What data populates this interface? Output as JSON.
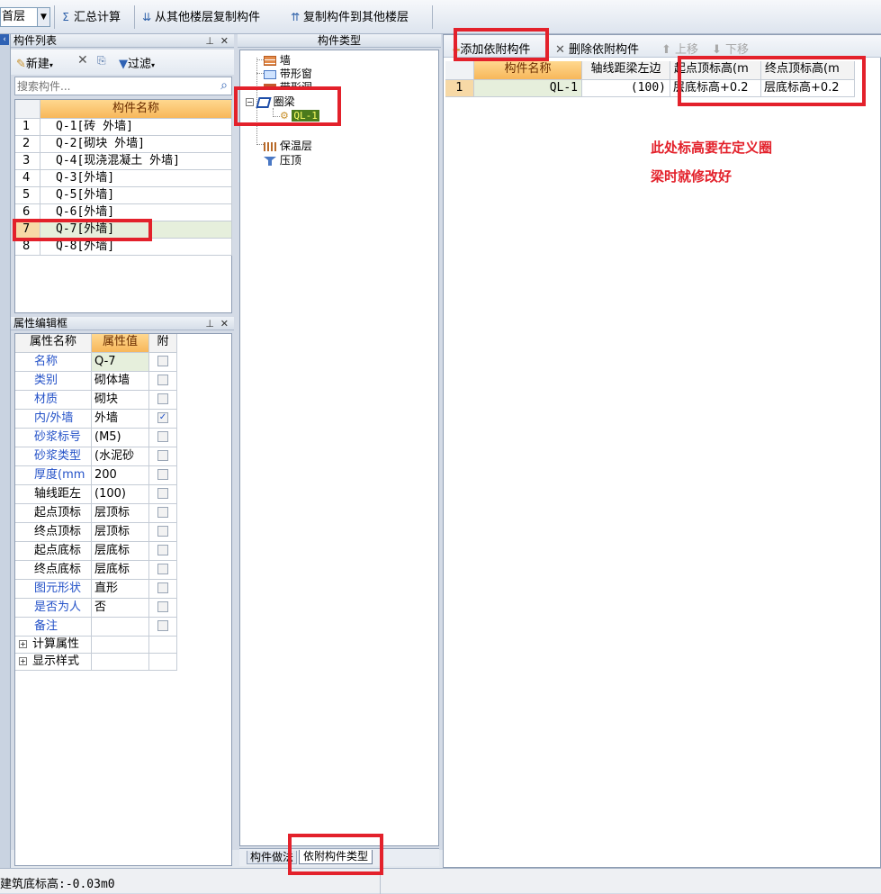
{
  "toolbar": {
    "floor_value": "首层",
    "sum_label": "汇总计算",
    "copy_from_label": "从其他楼层复制构件",
    "copy_to_label": "复制构件到其他楼层"
  },
  "component_list": {
    "title": "构件列表",
    "new_label": "新建",
    "filter_label": "过滤",
    "search_placeholder": "搜索构件...",
    "column_header": "构件名称",
    "rows": [
      {
        "num": "1",
        "name": "Q-1[砖 外墙]"
      },
      {
        "num": "2",
        "name": "Q-2[砌块 外墙]"
      },
      {
        "num": "3",
        "name": "Q-4[现浇混凝土 外墙]"
      },
      {
        "num": "4",
        "name": "Q-3[外墙]"
      },
      {
        "num": "5",
        "name": "Q-5[外墙]"
      },
      {
        "num": "6",
        "name": "Q-6[外墙]"
      },
      {
        "num": "7",
        "name": "Q-7[外墙]"
      },
      {
        "num": "8",
        "name": "Q-8[外墙]"
      }
    ]
  },
  "property_panel": {
    "title": "属性编辑框",
    "headers": {
      "name": "属性名称",
      "value": "属性值",
      "attach": "附"
    },
    "rows": [
      {
        "name": "名称",
        "value": "Q-7",
        "checked": false
      },
      {
        "name": "类别",
        "value": "砌体墙",
        "checked": false
      },
      {
        "name": "材质",
        "value": "砌块",
        "checked": false
      },
      {
        "name": "内/外墙",
        "value": "外墙",
        "checked": true
      },
      {
        "name": "砂浆标号",
        "value": "(M5)",
        "checked": false
      },
      {
        "name": "砂浆类型",
        "value": "(水泥砂",
        "checked": false
      },
      {
        "name": "厚度(mm",
        "value": "200",
        "checked": false
      },
      {
        "name": "轴线距左",
        "value": "(100)",
        "checked": false
      },
      {
        "name": "起点顶标",
        "value": "层顶标",
        "checked": false
      },
      {
        "name": "终点顶标",
        "value": "层顶标",
        "checked": false
      },
      {
        "name": "起点底标",
        "value": "层底标",
        "checked": false
      },
      {
        "name": "终点底标",
        "value": "层底标",
        "checked": false
      },
      {
        "name": "图元形状",
        "value": "直形",
        "checked": false
      },
      {
        "name": "是否为人",
        "value": "否",
        "checked": false
      },
      {
        "name": "备注",
        "value": "",
        "checked": false
      }
    ],
    "groups": [
      "计算属性",
      "显示样式"
    ]
  },
  "type_panel": {
    "title": "构件类型",
    "tree": [
      {
        "label": "墙"
      },
      {
        "label": "带形窗"
      },
      {
        "label": "带形洞"
      },
      {
        "label": "圈梁"
      },
      {
        "label": "QL-1"
      },
      {
        "label": "保温层"
      },
      {
        "label": "压顶"
      }
    ],
    "tabs": [
      "构件做法",
      "依附构件类型"
    ]
  },
  "attach_panel": {
    "add_label": "添加依附构件",
    "delete_label": "删除依附构件",
    "up_label": "上移",
    "down_label": "下移",
    "headers": [
      "构件名称",
      "轴线距梁左边",
      "起点顶标高(m",
      "终点顶标高(m"
    ],
    "row": {
      "num": "1",
      "name": "QL-1",
      "offset": "(100)",
      "start_top": "层底标高+0.2",
      "end_top": "层底标高+0.2"
    },
    "note_line1": "此处标高要在定义圈",
    "note_line2": "梁时就修改好"
  },
  "status_bar": {
    "text": "建筑底标高:-0.03m0"
  },
  "colors": {
    "highlight_red": "#e3212b",
    "header_orange": "#f7b75a",
    "link_blue": "#2452c8"
  }
}
